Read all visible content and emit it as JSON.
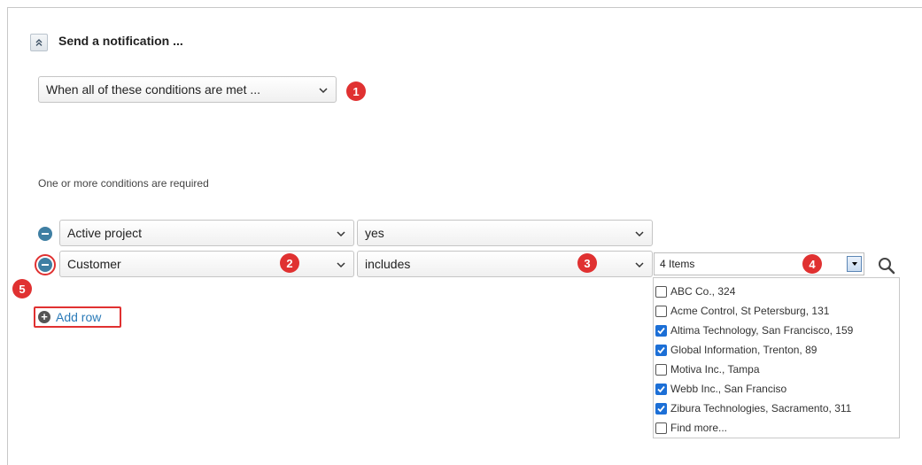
{
  "section": {
    "title": "Send a notification ...",
    "collapse_icon": "double-chevron-up-icon"
  },
  "condition_mode": {
    "value": "When all of these conditions are met ..."
  },
  "required_note": "One or more conditions are required",
  "rows": [
    {
      "field": "Active project",
      "operator": "yes"
    },
    {
      "field": "Customer",
      "operator": "includes"
    }
  ],
  "value_combo": {
    "text": "4 Items"
  },
  "dropdown_items": [
    {
      "label": "ABC Co., 324",
      "checked": false
    },
    {
      "label": "Acme Control, St Petersburg, 131",
      "checked": false
    },
    {
      "label": "Altima Technology, San Francisco, 159",
      "checked": true
    },
    {
      "label": "Global Information, Trenton, 89",
      "checked": true
    },
    {
      "label": "Motiva Inc., Tampa",
      "checked": false
    },
    {
      "label": "Webb Inc., San Franciso",
      "checked": true
    },
    {
      "label": "Zibura Technologies, Sacramento, 311",
      "checked": true
    },
    {
      "label": "Find more...",
      "checked": false
    }
  ],
  "add_row_label": "Add row",
  "callouts": [
    "1",
    "2",
    "3",
    "4",
    "5"
  ],
  "colors": {
    "callout": "#e03131",
    "link": "#2a7ab8",
    "remove": "#3f7fa3",
    "checkbox": "#1c6fd6"
  }
}
